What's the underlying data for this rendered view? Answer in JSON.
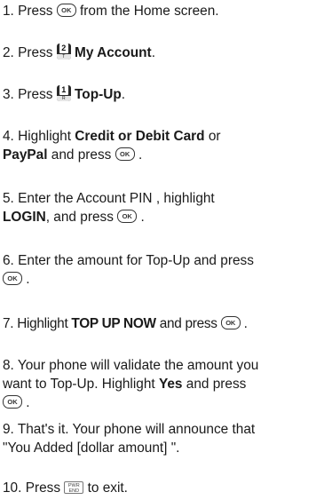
{
  "keys": {
    "ok": "OK",
    "key2_digit": "2",
    "key2_letters": "T",
    "key1_digit": "1",
    "key1_letters": "R",
    "end_top": "PWR",
    "end_bottom": "END"
  },
  "steps": [
    {
      "num": "1.",
      "t1": "Press",
      "t2": "from the Home screen."
    },
    {
      "num": "2.",
      "t1": "Press",
      "b1": "My Account",
      "t2": "."
    },
    {
      "num": "3.",
      "t1": "Press",
      "b1": "Top-Up",
      "t2": "."
    },
    {
      "num": "4.",
      "t1": "Highlight",
      "b1": "Credit or Debit Card",
      "t2": "or",
      "b2": "PayPal",
      "t3": "and press",
      "t4": "."
    },
    {
      "num": "5.",
      "t1": "Enter the Account PIN , highlight",
      "b1": "LOGIN",
      "t2": ", and press",
      "t3": "."
    },
    {
      "num": "6.",
      "t1": "Enter the amount for Top-Up and press",
      "t2": "."
    },
    {
      "num": "7.",
      "t1": "Highlight",
      "b1": "TOP UP NOW",
      "t2": "and press",
      "t3": "."
    },
    {
      "num": "8.",
      "t1": "Your phone will validate the amount you",
      "t2": "want to Top-Up. Highlight",
      "b1": "Yes",
      "t3": "and press",
      "t4": "."
    },
    {
      "num": "9.",
      "t1": "That's it. Your phone will announce that",
      "t2": "\"You Added [dollar amount] \"."
    },
    {
      "num": "10.",
      "t1": "Press",
      "t2": "to exit."
    }
  ]
}
